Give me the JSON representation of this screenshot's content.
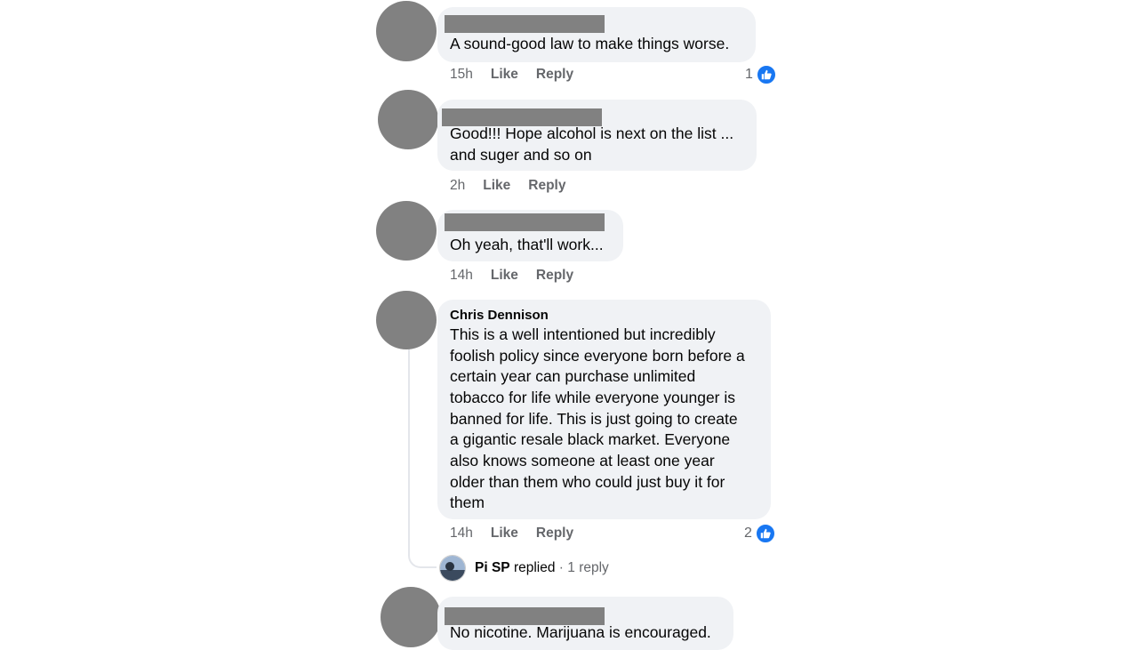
{
  "comments": [
    {
      "author_redacted": true,
      "text_lines": [
        "A sound-good law to make things worse."
      ],
      "time": "15h",
      "like_label": "Like",
      "reply_label": "Reply",
      "reaction_count": "1"
    },
    {
      "author_redacted": true,
      "text_lines": [
        "Good!!! Hope alcohol is next on the list ...",
        "and suger and so on"
      ],
      "time": "2h",
      "like_label": "Like",
      "reply_label": "Reply"
    },
    {
      "author_redacted": true,
      "text_lines": [
        "Oh yeah, that'll work..."
      ],
      "time": "14h",
      "like_label": "Like",
      "reply_label": "Reply"
    },
    {
      "author": "Chris Dennison",
      "text_lines": [
        "This is a well intentioned but incredibly",
        "foolish policy since everyone born before a",
        "certain year can purchase unlimited",
        "tobacco for life while everyone younger is",
        "banned for life. This is just going to create",
        "a gigantic resale black market. Everyone",
        "also knows someone at least one year",
        "older than them who could just buy it for",
        "them"
      ],
      "time": "14h",
      "like_label": "Like",
      "reply_label": "Reply",
      "reaction_count": "2",
      "reply_preview": {
        "name": "Pi SP",
        "action": "replied",
        "separator": "·",
        "count": "1 reply"
      }
    },
    {
      "author_redacted": true,
      "text_lines": [
        "No nicotine. Marijuana is encouraged."
      ]
    }
  ],
  "icons": {
    "reaction": "like-thumb-icon"
  },
  "colors": {
    "bubble": "#f0f2f5",
    "redaction": "#818181",
    "like_blue": "#1877f2",
    "meta_gray": "#65676b"
  }
}
